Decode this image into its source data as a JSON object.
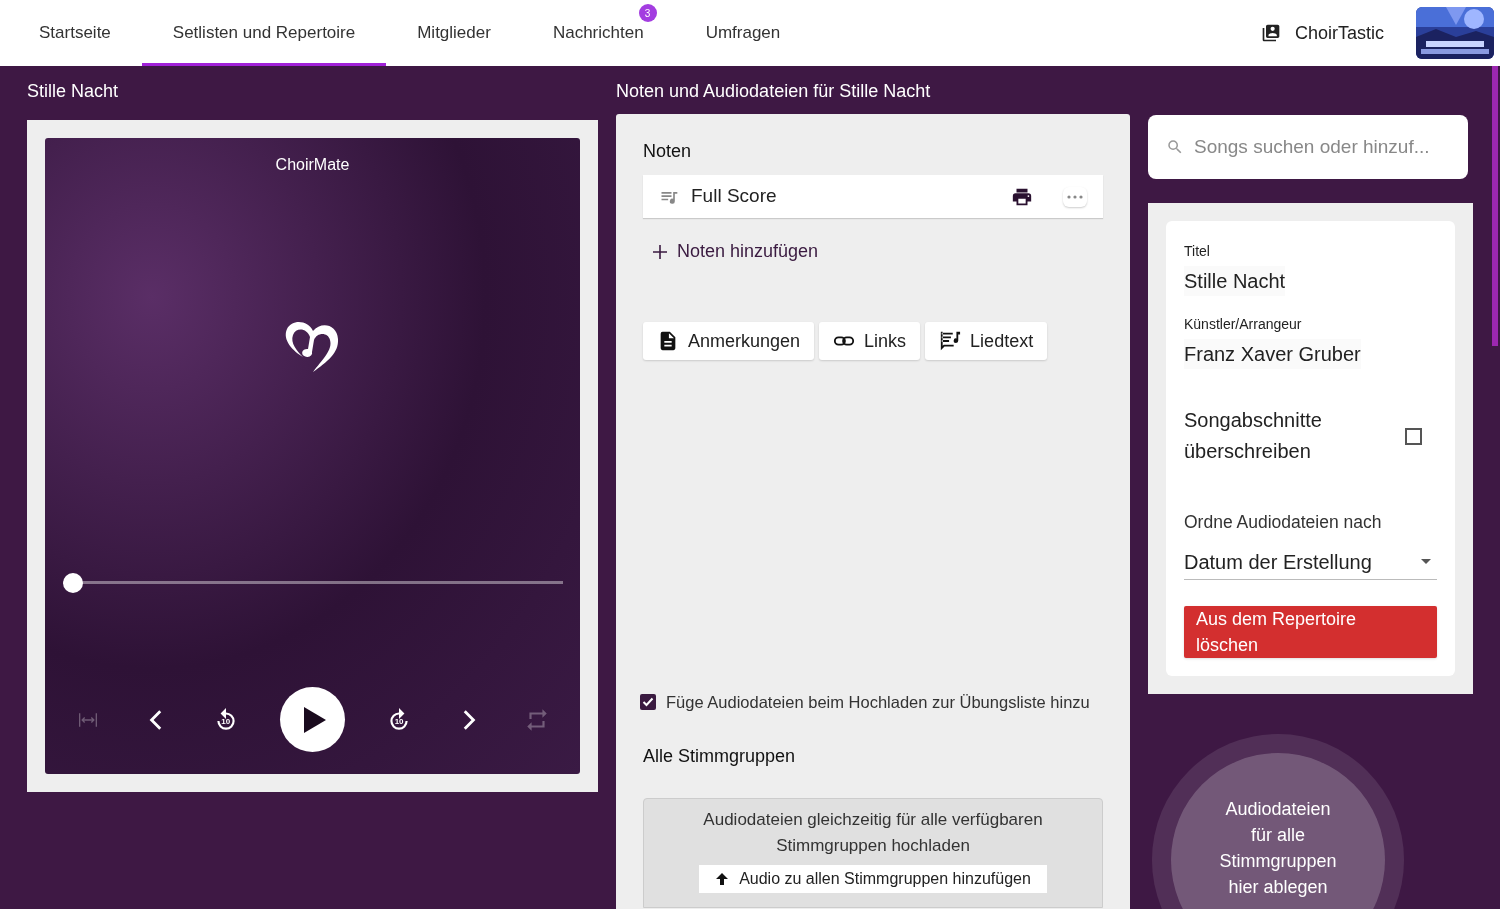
{
  "nav": {
    "tabs": [
      {
        "label": "Startseite",
        "selected": false
      },
      {
        "label": "Setlisten und Repertoire",
        "selected": true
      },
      {
        "label": "Mitglieder",
        "selected": false
      },
      {
        "label": "Nachrichten",
        "selected": false,
        "badge": "3"
      },
      {
        "label": "Umfragen",
        "selected": false
      }
    ],
    "choir": "ChoirTastic"
  },
  "player_section": {
    "title": "Stille Nacht",
    "player": {
      "brand": "ChoirMate",
      "progress": {
        "level": 0
      },
      "controls": [
        {
          "kind": "fit",
          "disabled": true
        },
        {
          "kind": "prev",
          "disabled": false
        },
        {
          "kind": "back10",
          "disabled": false,
          "label": "10"
        },
        {
          "kind": "play",
          "disabled": false
        },
        {
          "kind": "fwd10",
          "disabled": false,
          "label": "10"
        },
        {
          "kind": "next",
          "disabled": false
        },
        {
          "kind": "repeat",
          "disabled": true
        }
      ]
    }
  },
  "files_section": {
    "title": "Noten und Audiodateien für Stille Nacht",
    "scores_heading": "Noten",
    "scores": [
      {
        "name": "Full Score"
      }
    ],
    "add_score": "Noten hinzufügen",
    "extra_buttons": [
      {
        "kind": "notes",
        "label": "Anmerkungen"
      },
      {
        "kind": "links",
        "label": "Links"
      },
      {
        "kind": "lyrics",
        "label": "Liedtext"
      }
    ],
    "practice_checkbox": {
      "label": "Füge Audiodateien beim Hochladen zur Übungsliste hinzu",
      "checked": true
    },
    "voice_group": "Alle Stimmgruppen",
    "upload_box": {
      "text": "Audiodateien gleichzeitig für alle verfügbaren Stimmgruppen hochladen",
      "button": "Audio zu allen Stimmgruppen hinzufügen"
    }
  },
  "search": {
    "placeholder": "Songs suchen oder hinzuf..."
  },
  "details": {
    "title_label": "Titel",
    "title": "Stille Nacht",
    "artist_label": "Künstler/Arrangeur",
    "artist": "Franz Xaver Gruber",
    "override": {
      "label": "Songabschnitte überschreiben",
      "checked": false
    },
    "sort_label": "Ordne Audiodateien nach",
    "sort_value": "Datum der Erstellung",
    "delete_button": "Aus dem Repertoire löschen"
  },
  "drop_zone": "Audiodateien für alle Stimmgruppen hier ablegen"
}
